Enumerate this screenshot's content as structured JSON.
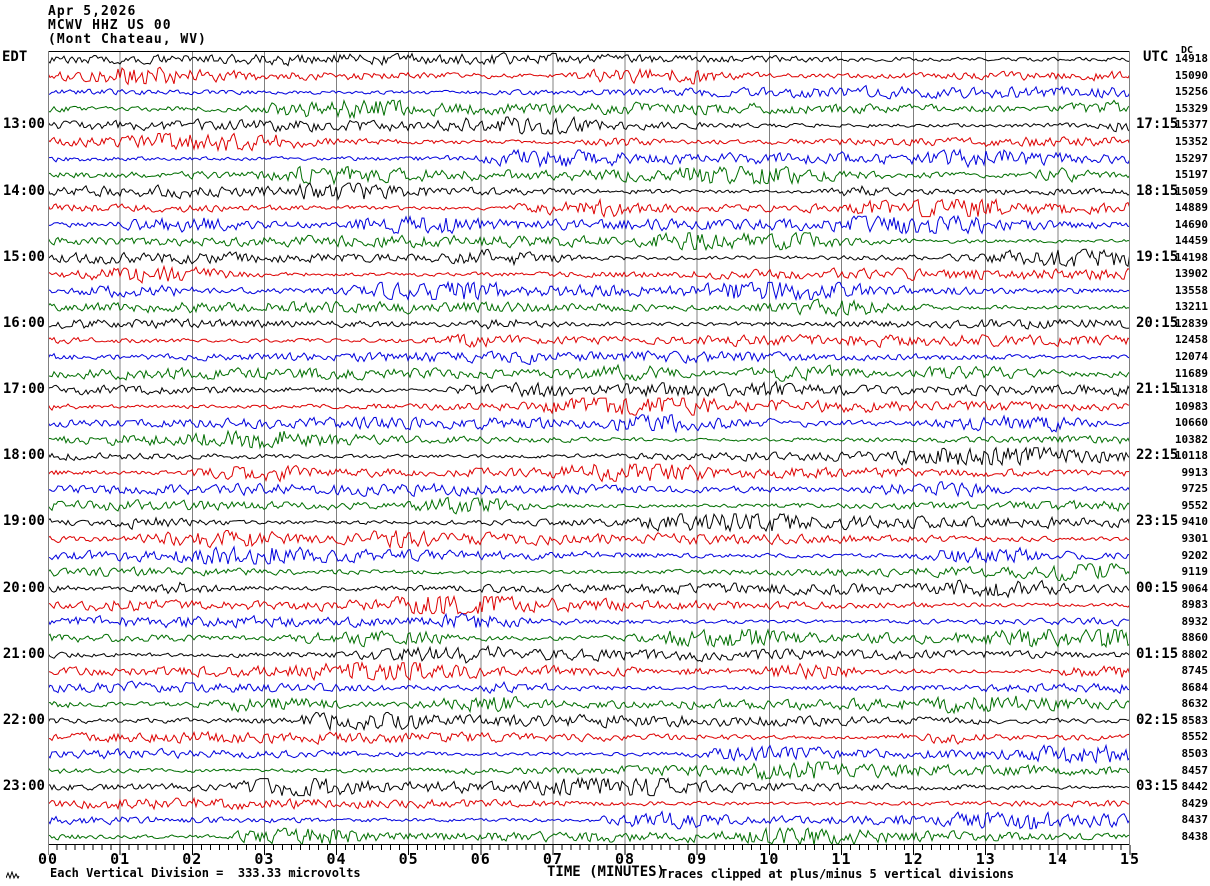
{
  "header": {
    "date": "Apr 5,2026",
    "station": "MCWV HHZ US 00",
    "location": "(Mont Chateau, WV)"
  },
  "left_axis": {
    "label": "EDT",
    "hour_labels": [
      "13:00",
      "14:00",
      "15:00",
      "16:00",
      "17:00",
      "18:00",
      "19:00",
      "20:00",
      "21:00",
      "22:00",
      "23:00"
    ],
    "label_rows": [
      4,
      8,
      12,
      16,
      20,
      24,
      28,
      32,
      36,
      40,
      44
    ]
  },
  "right_axis": {
    "label": "UTC",
    "dc_label": "DC",
    "hour_labels": [
      "17:15",
      "18:15",
      "19:15",
      "20:15",
      "21:15",
      "22:15",
      "23:15",
      "00:15",
      "01:15",
      "02:15",
      "03:15"
    ],
    "label_rows": [
      4,
      8,
      12,
      16,
      20,
      24,
      28,
      32,
      36,
      40,
      44
    ]
  },
  "x_axis": {
    "tick_labels": [
      "00",
      "01",
      "02",
      "03",
      "04",
      "05",
      "06",
      "07",
      "08",
      "09",
      "10",
      "11",
      "12",
      "13",
      "14",
      "15"
    ],
    "title": "TIME (MINUTES)"
  },
  "footer": {
    "scale_note": "Each Vertical Division =  333.33 microvolts",
    "clip_note": "Traces clipped at plus/minus 5 vertical divisions"
  },
  "colors": {
    "trace_cycle": [
      "#000000",
      "#dd0000",
      "#0000dd",
      "#006e00"
    ],
    "grid": "#808080",
    "side_border": "#808080",
    "frame": "#000000"
  },
  "chart_data": {
    "type": "line",
    "subtype": "helicorder-seismogram",
    "title": "MCWV HHZ US 00 (Mont Chateau, WV) Apr 5,2026",
    "station": "MCWV HHZ US 00",
    "station_name": "Mont Chateau, WV",
    "date": "Apr 5,2026",
    "xlabel": "TIME (MINUTES)",
    "x_range_minutes": [
      0,
      15
    ],
    "minutes_per_row": 15,
    "num_rows": 48,
    "row_color_cycle": [
      "black",
      "red",
      "blue",
      "green"
    ],
    "left_time_zone": "EDT",
    "right_time_zone": "UTC",
    "left_hour_marks_edt": [
      "13:00",
      "14:00",
      "15:00",
      "16:00",
      "17:00",
      "18:00",
      "19:00",
      "20:00",
      "21:00",
      "22:00",
      "23:00"
    ],
    "right_hour_marks_utc": [
      "17:15",
      "18:15",
      "19:15",
      "20:15",
      "21:15",
      "22:15",
      "23:15",
      "00:15",
      "01:15",
      "02:15",
      "03:15"
    ],
    "dc_offset_per_row": [
      14918,
      15090,
      15256,
      15329,
      15377,
      15352,
      15297,
      15197,
      15059,
      14889,
      14690,
      14459,
      14198,
      13902,
      13558,
      13211,
      12839,
      12458,
      12074,
      11689,
      11318,
      10983,
      10660,
      10382,
      10118,
      9913,
      9725,
      9552,
      9410,
      9301,
      9202,
      9119,
      9064,
      8983,
      8932,
      8860,
      8802,
      8745,
      8684,
      8632,
      8583,
      8552,
      8503,
      8457,
      8442,
      8429,
      8437,
      8438
    ],
    "vertical_division_microvolts": 333.33,
    "clip_limit_divisions": 5,
    "minor_ticks_per_minute": 8,
    "waveform_note": "continuous background seismic noise, traces not individually resolvable"
  }
}
